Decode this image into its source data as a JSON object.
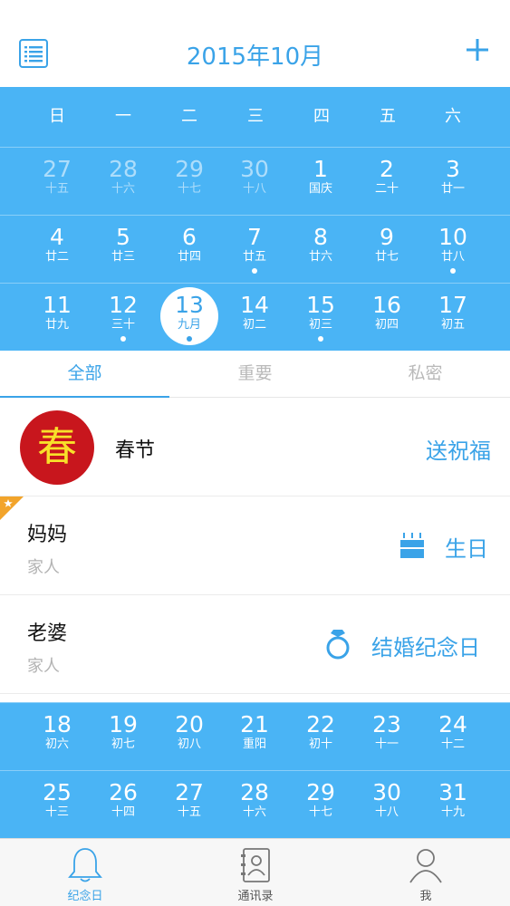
{
  "header": {
    "title": "2015年10月",
    "menu_icon": "list-icon",
    "add_icon": "plus-icon"
  },
  "weekdays": [
    "日",
    "一",
    "二",
    "三",
    "四",
    "五",
    "六"
  ],
  "calendar_top": [
    [
      {
        "day": "27",
        "lunar": "十五",
        "faded": true
      },
      {
        "day": "28",
        "lunar": "十六",
        "faded": true
      },
      {
        "day": "29",
        "lunar": "十七",
        "faded": true
      },
      {
        "day": "30",
        "lunar": "十八",
        "faded": true
      },
      {
        "day": "1",
        "lunar": "国庆"
      },
      {
        "day": "2",
        "lunar": "二十"
      },
      {
        "day": "3",
        "lunar": "廿一"
      }
    ],
    [
      {
        "day": "4",
        "lunar": "廿二"
      },
      {
        "day": "5",
        "lunar": "廿三"
      },
      {
        "day": "6",
        "lunar": "廿四"
      },
      {
        "day": "7",
        "lunar": "廿五",
        "dot": true
      },
      {
        "day": "8",
        "lunar": "廿六"
      },
      {
        "day": "9",
        "lunar": "廿七"
      },
      {
        "day": "10",
        "lunar": "廿八",
        "dot": true
      }
    ],
    [
      {
        "day": "11",
        "lunar": "廿九"
      },
      {
        "day": "12",
        "lunar": "三十",
        "dot": true
      },
      {
        "day": "13",
        "lunar": "九月",
        "dot": true,
        "selected": true
      },
      {
        "day": "14",
        "lunar": "初二"
      },
      {
        "day": "15",
        "lunar": "初三",
        "dot": true
      },
      {
        "day": "16",
        "lunar": "初四"
      },
      {
        "day": "17",
        "lunar": "初五"
      }
    ]
  ],
  "calendar_bottom": [
    [
      {
        "day": "18",
        "lunar": "初六"
      },
      {
        "day": "19",
        "lunar": "初七"
      },
      {
        "day": "20",
        "lunar": "初八"
      },
      {
        "day": "21",
        "lunar": "重阳"
      },
      {
        "day": "22",
        "lunar": "初十"
      },
      {
        "day": "23",
        "lunar": "十一"
      },
      {
        "day": "24",
        "lunar": "十二"
      }
    ],
    [
      {
        "day": "25",
        "lunar": "十三"
      },
      {
        "day": "26",
        "lunar": "十四"
      },
      {
        "day": "27",
        "lunar": "十五"
      },
      {
        "day": "28",
        "lunar": "十六"
      },
      {
        "day": "29",
        "lunar": "十七"
      },
      {
        "day": "30",
        "lunar": "十八"
      },
      {
        "day": "31",
        "lunar": "十九"
      }
    ]
  ],
  "tabs": [
    {
      "label": "全部",
      "active": true
    },
    {
      "label": "重要"
    },
    {
      "label": "私密"
    }
  ],
  "events": {
    "spring": {
      "badge": "春",
      "title": "春节",
      "action": "送祝福"
    },
    "mom": {
      "title": "妈妈",
      "subtitle": "家人",
      "action": "生日",
      "icon": "birthday-cake-icon",
      "starred": true
    },
    "wife": {
      "title": "老婆",
      "subtitle": "家人",
      "action": "结婚纪念日",
      "icon": "ring-icon"
    }
  },
  "tabbar": [
    {
      "label": "纪念日",
      "icon": "bell-icon",
      "active": true
    },
    {
      "label": "通讯录",
      "icon": "contacts-book-icon"
    },
    {
      "label": "我",
      "icon": "person-icon"
    }
  ],
  "colors": {
    "accent": "#3aa3e8",
    "calendar_bg": "#4ab4f5",
    "badge_red": "#c8161d"
  }
}
